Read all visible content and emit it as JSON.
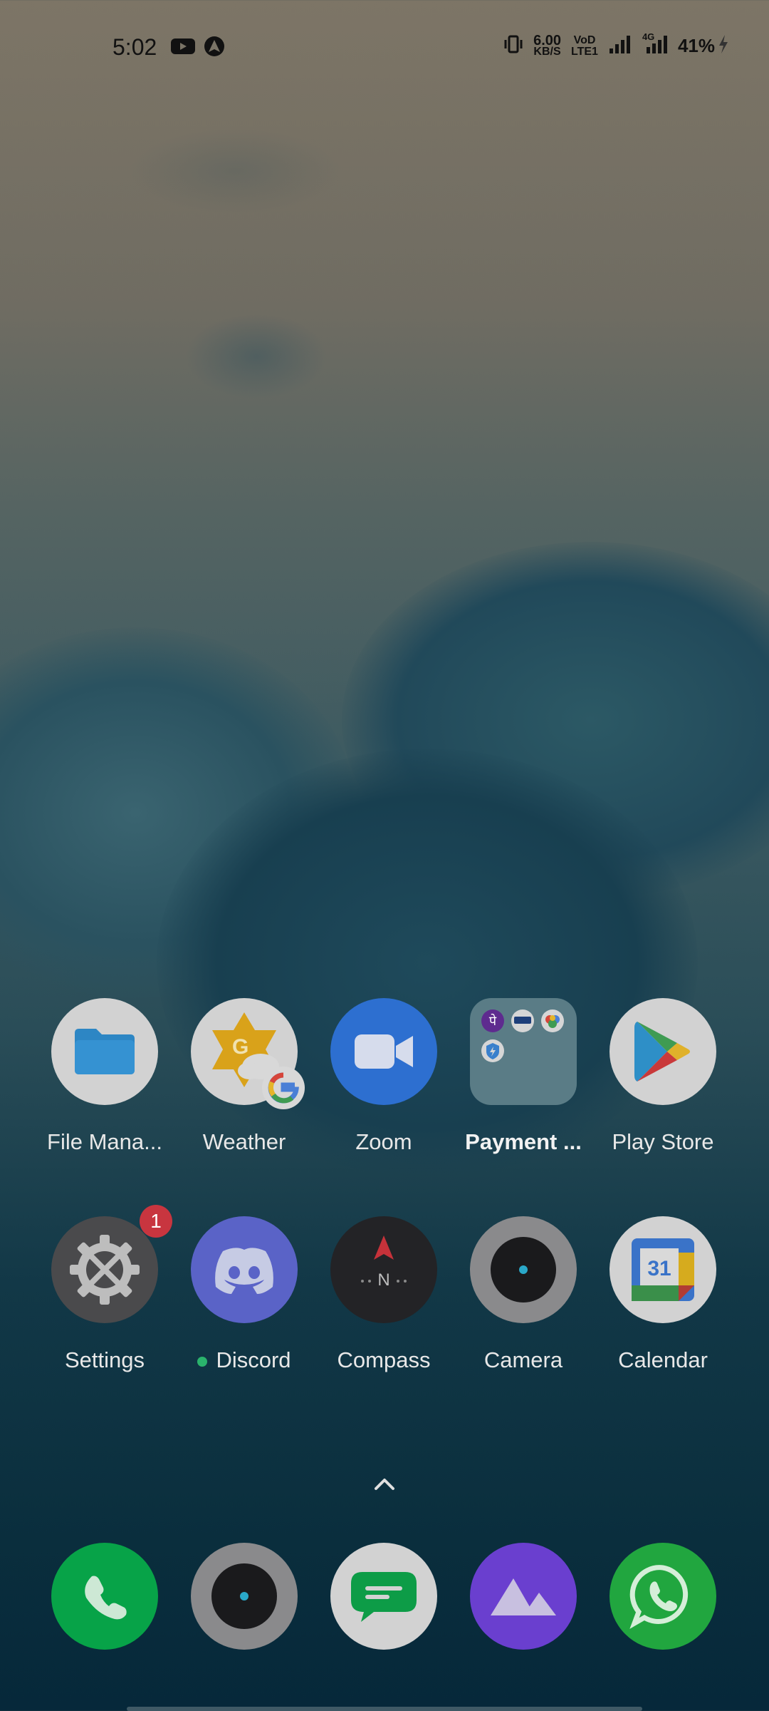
{
  "status_bar": {
    "time": "5:02",
    "notification_icons": [
      "youtube-icon",
      "assistant-icon"
    ],
    "net_speed_value": "6.00",
    "net_speed_unit": "KB/S",
    "volte_label_top": "VoD",
    "volte_label_bottom": "LTE1",
    "network_type": "4G",
    "battery": "41%"
  },
  "home": {
    "row1": [
      {
        "label": "File Mana...",
        "icon": "folder-icon"
      },
      {
        "label": "Weather",
        "icon": "weather-icon"
      },
      {
        "label": "Zoom",
        "icon": "video-camera-icon"
      },
      {
        "label": "Payment ...",
        "icon": "folder-group-icon"
      },
      {
        "label": "Play Store",
        "icon": "play-store-icon"
      }
    ],
    "row2": [
      {
        "label": "Settings",
        "icon": "gear-icon",
        "badge": "1"
      },
      {
        "label": "Discord",
        "icon": "discord-icon"
      },
      {
        "label": "Compass",
        "icon": "compass-icon",
        "compass_letter": "N"
      },
      {
        "label": "Camera",
        "icon": "camera-icon"
      },
      {
        "label": "Calendar",
        "icon": "calendar-icon",
        "day": "31"
      }
    ],
    "payment_folder_letter": "पे"
  },
  "dock": [
    {
      "icon": "phone-icon"
    },
    {
      "icon": "camera-icon"
    },
    {
      "icon": "messages-icon"
    },
    {
      "icon": "gallery-icon"
    },
    {
      "icon": "whatsapp-icon"
    }
  ],
  "colors": {
    "phone": "#07a348",
    "zoom": "#2d6fd0",
    "discord": "#5a63c7",
    "gallery": "#6a3fcf",
    "whatsapp": "#21a63f",
    "badge": "#c8353f"
  }
}
